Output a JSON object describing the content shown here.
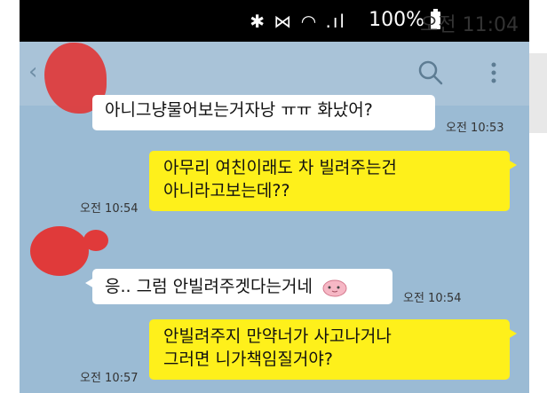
{
  "status_bar": {
    "icons": "✱ ⋈ ◠ .ıl",
    "battery_pct": "100%",
    "time": "오전 11:04"
  },
  "header": {
    "back_glyph": "‹",
    "contact_name": "",
    "icon_search": "search-icon",
    "icon_menu": "kebab-menu-icon"
  },
  "messages": [
    {
      "side": "left",
      "text": "아니그냥물어보는거자낭 ㅠㅠ 화났어?",
      "time": "오전 10:53"
    },
    {
      "side": "right",
      "lines": [
        "아무리 여친이래도 차 빌려주는건",
        "아니라고보는데??"
      ],
      "time": "오전 10:54"
    },
    {
      "side": "left",
      "text": "응.. 그럼 안빌려주겟다는거네",
      "emoticon": "pink-blob-emoticon",
      "time": "오전 10:54"
    },
    {
      "side": "right",
      "lines": [
        "안빌려주지 만약너가 사고나거나",
        "그러면 니가책임질거야?"
      ],
      "time": "오전 10:57"
    }
  ],
  "colors": {
    "chat_bg": "#9bbbd4",
    "my_bubble": "#fef01b",
    "their_bubble": "#ffffff",
    "redaction": "#e03a3a"
  }
}
